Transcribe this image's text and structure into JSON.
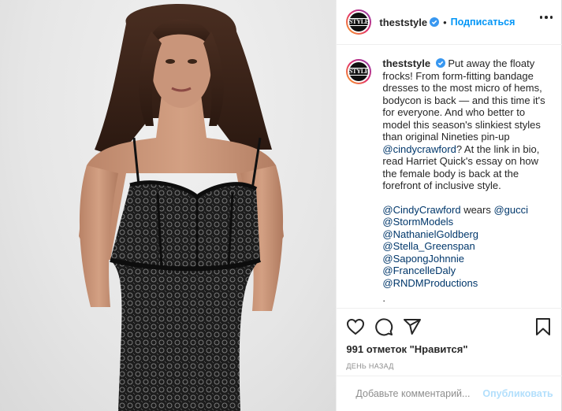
{
  "post": {
    "username": "theststyle",
    "avatar_text": "STYLE",
    "follow_label": "Подписаться",
    "separator": "•",
    "photo": {
      "subject": "woman-in-black-lace-corset-dress"
    },
    "caption": {
      "username": "theststyle",
      "text_before": "Put away the floaty frocks! From form-fitting bandage dresses to the most micro of hems, bodycon is back — and this time it's for everyone. And who better to model this season's slinkiest styles than original Nineties pin-up ",
      "inline_mention": "@cindycrawford",
      "text_after": "? At the link in bio, read Harriet Quick's essay on how the female body is back at the forefront of inclusive style.",
      "credit_mention": "@CindyCrawford",
      "credit_wears": " wears ",
      "credit_brand": "@gucci",
      "tags": [
        "@StormModels",
        "@NathanielGoldberg",
        "@Stella_Greenspan",
        "@SapongJohnnie",
        "@FrancelleDaly",
        "@RNDMProductions"
      ],
      "overflow": "."
    },
    "likes": "991 отметок \"Нравится\"",
    "time": "ДЕНЬ НАЗАД",
    "comment_placeholder": "Добавьте комментарий...",
    "post_label": "Опубликовать",
    "icons": {
      "like": "heart-icon",
      "comment": "comment-icon",
      "share": "share-icon",
      "save": "bookmark-icon",
      "emoji": "emoji-icon",
      "more": "more-icon",
      "verified": "verified-badge-icon"
    },
    "colors": {
      "link_blue": "#0095f6",
      "mention": "#00376b",
      "text": "#262626",
      "muted": "#8e8e8e",
      "post_disabled": "#b2dffc"
    }
  }
}
